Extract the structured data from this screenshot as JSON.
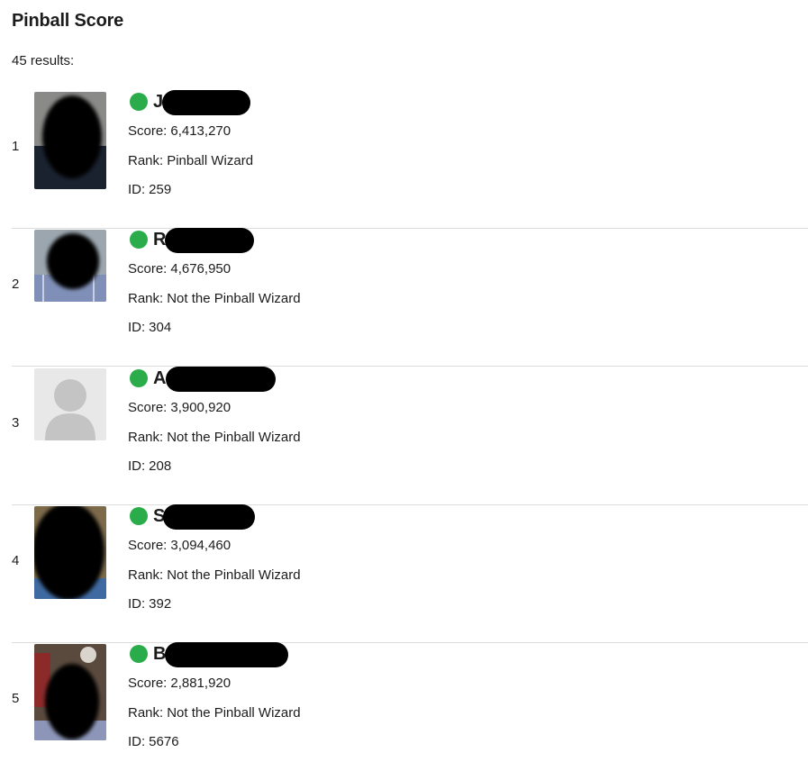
{
  "page": {
    "title": "Pinball Score",
    "results_text": "45 results:",
    "score_label": "Score:",
    "rank_label": "Rank:",
    "id_label": "ID:"
  },
  "entries": [
    {
      "position": "1",
      "initial": "J",
      "score": "6,413,270",
      "rank": "Pinball Wizard",
      "id": "259",
      "online": true,
      "avatar": "redacted-photo"
    },
    {
      "position": "2",
      "initial": "R",
      "score": "4,676,950",
      "rank": "Not the Pinball Wizard",
      "id": "304",
      "online": true,
      "avatar": "redacted-photo"
    },
    {
      "position": "3",
      "initial": "A",
      "score": "3,900,920",
      "rank": "Not the Pinball Wizard",
      "id": "208",
      "online": true,
      "avatar": "default-user-icon"
    },
    {
      "position": "4",
      "initial": "S",
      "score": "3,094,460",
      "rank": "Not the Pinball Wizard",
      "id": "392",
      "online": true,
      "avatar": "redacted-photo"
    },
    {
      "position": "5",
      "initial": "B",
      "score": "2,881,920",
      "rank": "Not the Pinball Wizard",
      "id": "5676",
      "online": true,
      "avatar": "redacted-photo"
    }
  ],
  "colors": {
    "presence_online": "#2bac4a",
    "text": "#1d1c1d",
    "divider": "#dddddd"
  }
}
